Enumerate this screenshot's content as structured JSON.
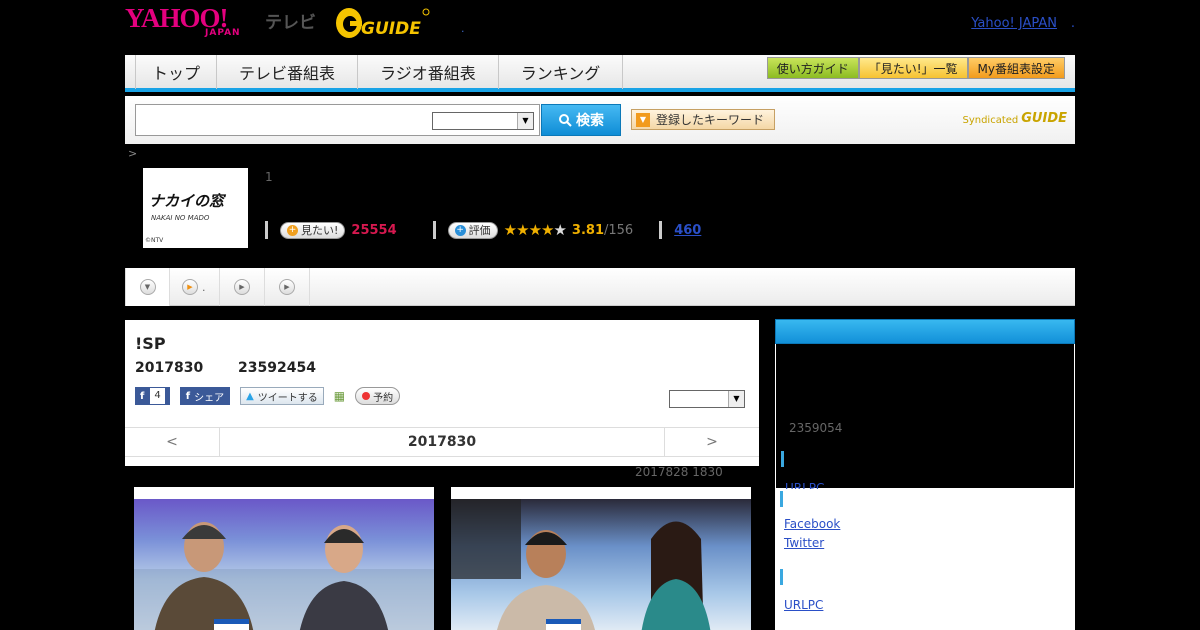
{
  "header": {
    "brand_yahoo": "YAHOO!",
    "brand_japan": "JAPAN",
    "brand_tv": "テレビ",
    "brand_guide": "GUIDE",
    "dot": ".",
    "yahoo_japan_link": "Yahoo! JAPAN",
    "link_suffix": "."
  },
  "nav": {
    "tabs": [
      "トップ",
      "テレビ番組表",
      "ラジオ番組表",
      "ランキング"
    ],
    "buttons": [
      "使い方ガイド",
      "「見たい!」一覧",
      "My番組表設定"
    ]
  },
  "search": {
    "button_label": "検索",
    "keyword_button": "登録したキーワード",
    "syndicated": "Syndicated",
    "syndicated_logo": "GUIDE"
  },
  "breadcrumb": ">",
  "show": {
    "thumb_title": "ナカイの窓",
    "thumb_sub": "NAKAI NO MADO",
    "thumb_credit": "©NTV",
    "number": "1",
    "mitai_label": "見たい!",
    "mitai_count": "25554",
    "hyoka_label": "評価",
    "stars_filled": 3.5,
    "rating": "3.81",
    "rating_count": "/156",
    "review_count": "460"
  },
  "tabbar": {
    "items": [
      "",
      ".",
      "",
      ""
    ]
  },
  "episode": {
    "title": "!SP",
    "date": "2017830",
    "id": "23592454",
    "like_count": "4",
    "share_label": "シェア",
    "tweet_label": "ツイートする",
    "reserve_label": "予約",
    "pager_prev": "<",
    "pager_current": "2017830",
    "pager_next": ">",
    "updated": "2017828  1830"
  },
  "sidebar": {
    "number": "2359054",
    "link1": "URLPC",
    "link_facebook": "Facebook",
    "link_twitter": "Twitter",
    "link2": "URLPC"
  },
  "colors": {
    "accent_blue": "#19a3e6",
    "brand_magenta": "#e4007f",
    "mitai_red": "#d6184f",
    "star_gold": "#f0b000"
  }
}
